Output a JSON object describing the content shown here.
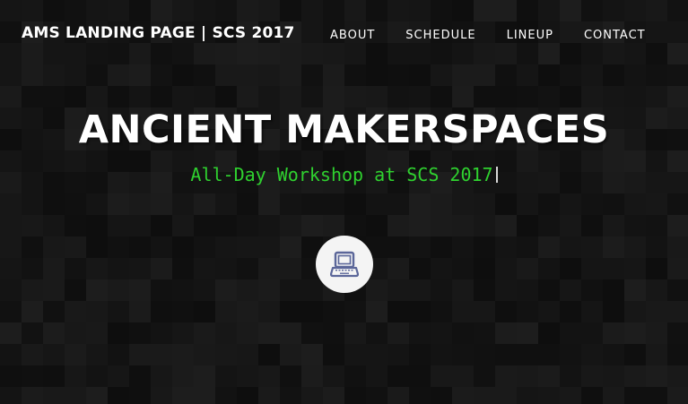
{
  "header": {
    "brand": "AMS LANDING PAGE | SCS 2017",
    "nav": [
      {
        "label": "ABOUT"
      },
      {
        "label": "SCHEDULE"
      },
      {
        "label": "LINEUP"
      },
      {
        "label": "CONTACT"
      }
    ]
  },
  "hero": {
    "title": "ANCIENT MAKERSPACES",
    "subtitle": "All-Day Workshop at SCS 2017",
    "icon": "laptop-icon"
  },
  "colors": {
    "background": "#151515",
    "text": "#ffffff",
    "subtitle": "#2fd12f",
    "icon_circle": "#f4f4f4",
    "icon": "#5b6699"
  }
}
